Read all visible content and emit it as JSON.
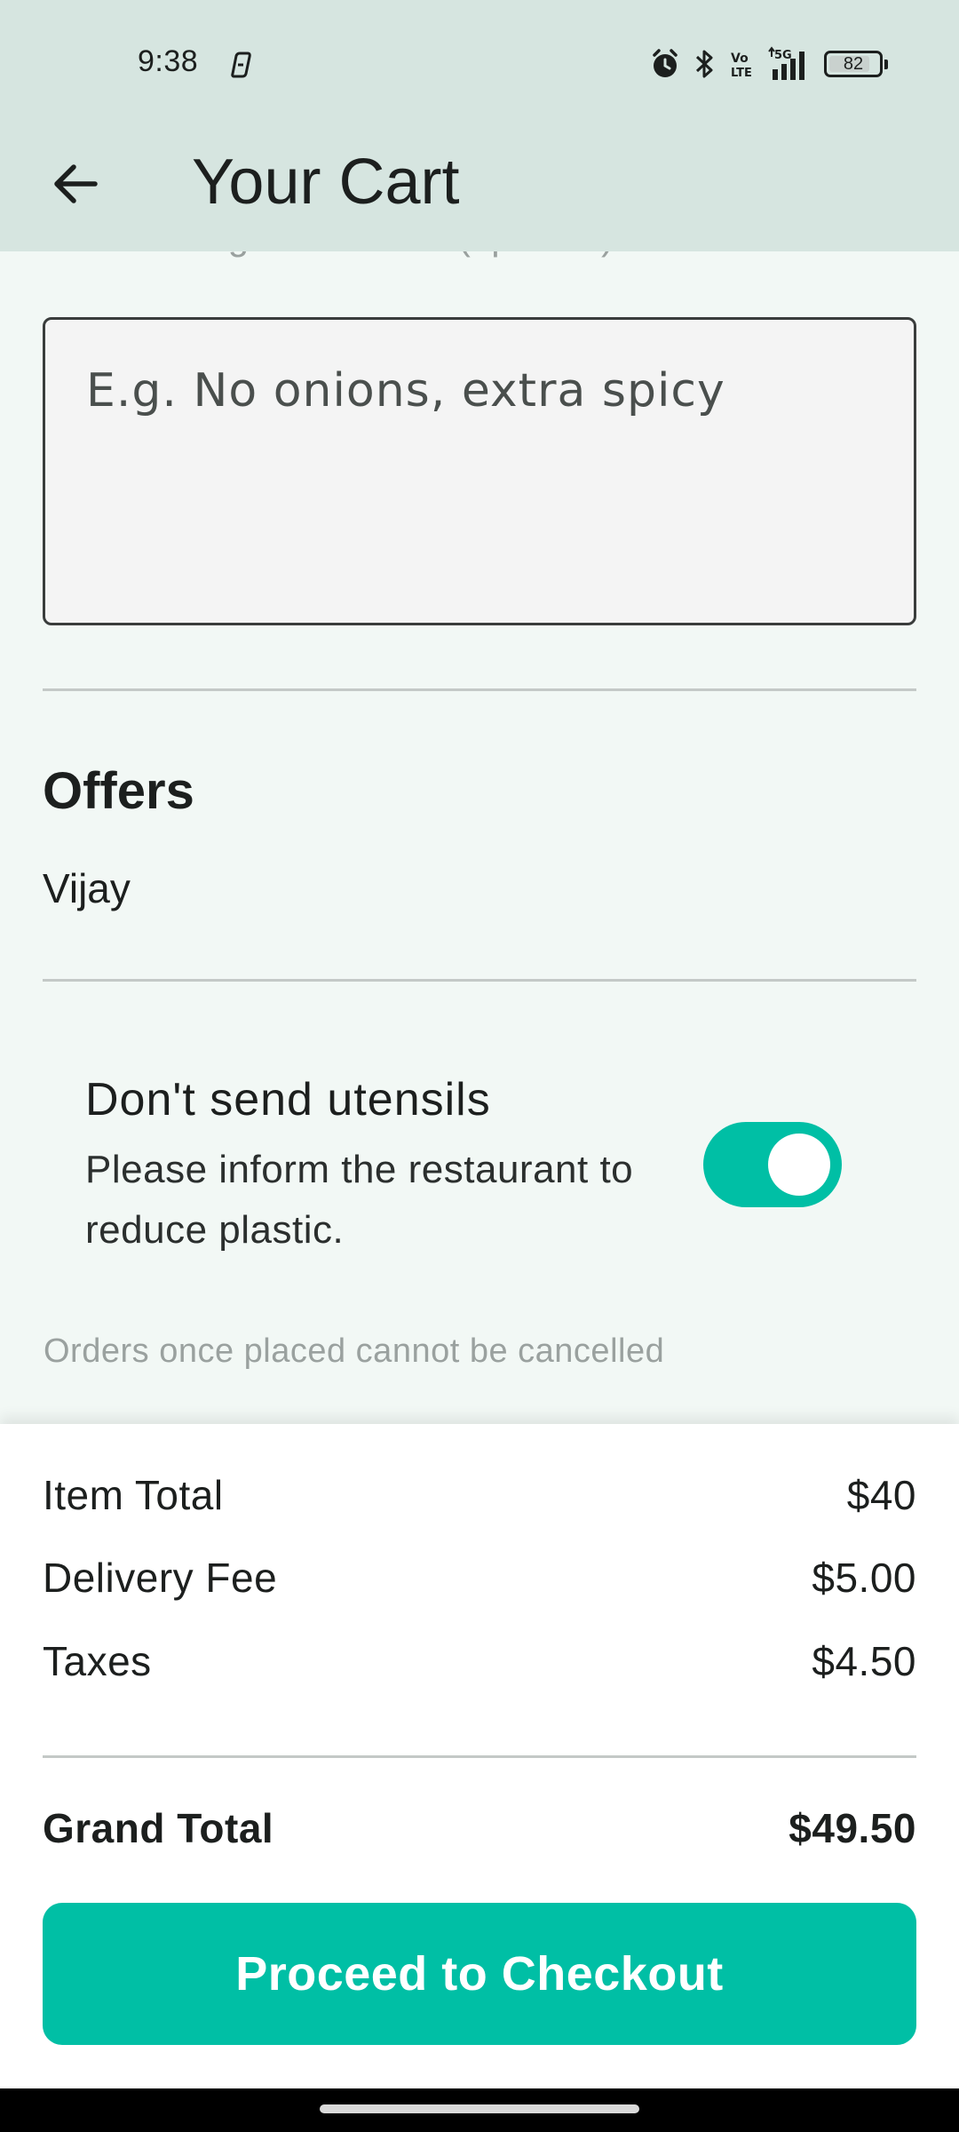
{
  "status_bar": {
    "time": "9:38",
    "battery": "82",
    "icons": [
      "copilot-icon",
      "alarm-icon",
      "bluetooth-icon",
      "volte-icon",
      "5g-signal-icon",
      "battery-icon"
    ]
  },
  "app_bar": {
    "title": "Your Cart",
    "back_icon": "arrow-back-icon"
  },
  "instructions": {
    "label": "Add cooking instructions (optional)",
    "placeholder": "E.g. No onions, extra spicy"
  },
  "offers": {
    "title": "Offers",
    "value": "Vijay"
  },
  "utensils": {
    "title": "Don't send utensils",
    "description": "Please inform the restaurant to reduce plastic.",
    "enabled": true
  },
  "cancel_note": "Orders once placed cannot be cancelled",
  "summary": {
    "rows": [
      {
        "label": "Item Total",
        "value": "$40"
      },
      {
        "label": "Delivery Fee",
        "value": "$5.00"
      },
      {
        "label": "Taxes",
        "value": "$4.50"
      }
    ],
    "grand_total": {
      "label": "Grand Total",
      "value": "$49.50"
    },
    "checkout_label": "Proceed to Checkout"
  },
  "colors": {
    "accent": "#00bfa5",
    "topbar": "#d6e5e0",
    "background": "#f2f8f5"
  }
}
